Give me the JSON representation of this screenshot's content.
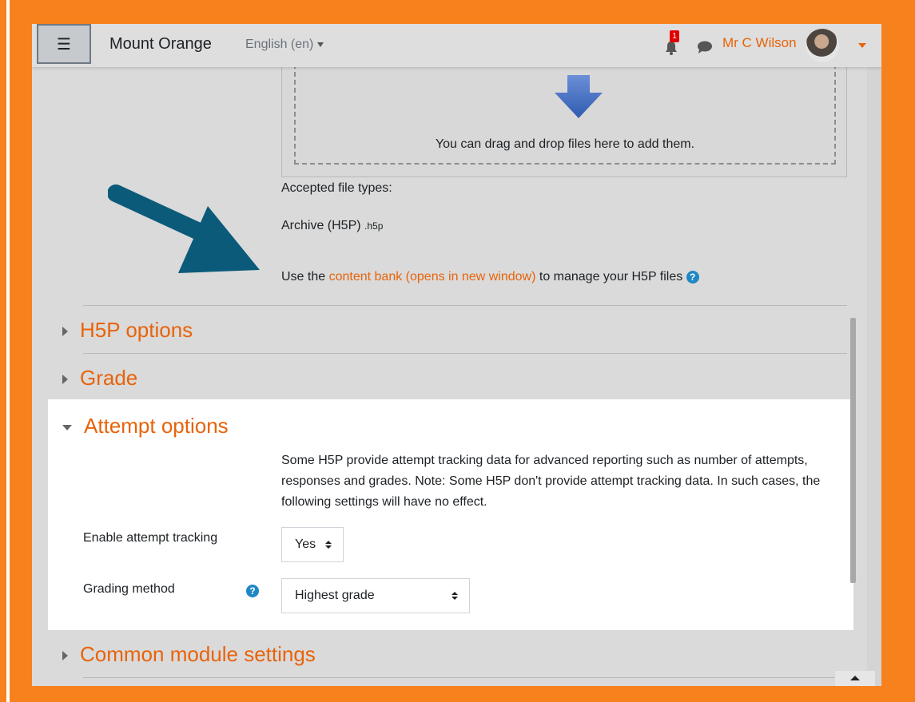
{
  "navbar": {
    "menu_icon": "hamburger-icon",
    "site_name": "Mount Orange",
    "language": "English (en)",
    "notification_count": "1",
    "user_name": "Mr C Wilson"
  },
  "upload": {
    "drop_text": "You can drag and drop files here to add them.",
    "accepted_label": "Accepted file types:",
    "archive_label": "Archive (H5P)",
    "archive_ext": ".h5p",
    "content_bank_pre": "Use the ",
    "content_bank_link": "content bank (opens in new window)",
    "content_bank_post": " to manage your H5P files"
  },
  "sections": {
    "h5p_options": "H5P options",
    "grade": "Grade",
    "attempt_options": "Attempt options",
    "common_module_settings": "Common module settings"
  },
  "attempt": {
    "description": "Some H5P provide attempt tracking data for advanced reporting such as number of attempts, responses and grades. Note: Some H5P don't provide attempt tracking data. In such cases, the following settings will have no effect.",
    "tracking_label": "Enable attempt tracking",
    "tracking_value": "Yes",
    "grading_label": "Grading method",
    "grading_value": "Highest grade"
  },
  "colors": {
    "accent": "#e8630a",
    "frame": "#f7811c",
    "annotation_arrow": "#0b5a7a",
    "help": "#1e88c5"
  }
}
